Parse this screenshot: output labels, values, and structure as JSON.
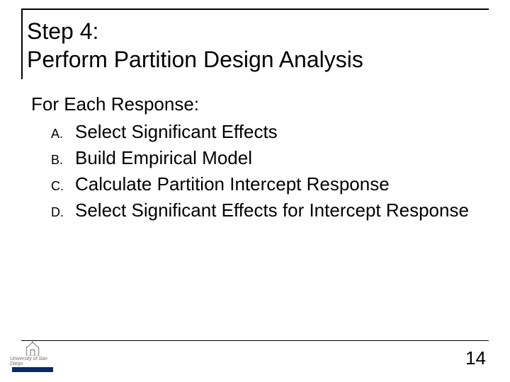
{
  "title": {
    "line1": "Step 4:",
    "line2": "Perform Partition Design Analysis"
  },
  "body": {
    "lead": "For Each Response:",
    "items": [
      {
        "marker": "A.",
        "text": "Select Significant Effects"
      },
      {
        "marker": "B.",
        "text": "Build Empirical Model"
      },
      {
        "marker": "C.",
        "text": "Calculate Partition Intercept Response"
      },
      {
        "marker": "D.",
        "text": "Select Significant Effects for Intercept Response"
      }
    ]
  },
  "footer": {
    "institution": "University of San Diego",
    "page_number": "14"
  }
}
